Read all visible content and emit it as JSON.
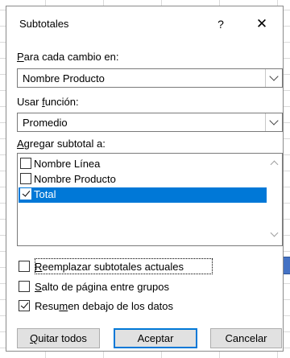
{
  "dialog": {
    "title": "Subtotales",
    "help_glyph": "?",
    "close_glyph": "✕"
  },
  "group_by": {
    "label_underlined": "P",
    "label_rest": "ara cada cambio en:",
    "value": "Nombre Producto"
  },
  "function": {
    "label_start": "Usar ",
    "label_underlined": "f",
    "label_rest": "unción:",
    "value": "Promedio"
  },
  "add_subtotal": {
    "label_underlined": "A",
    "label_rest": "gregar subtotal a:",
    "items": [
      {
        "label": "Nombre Línea",
        "checked": false,
        "selected": false
      },
      {
        "label": "Nombre Producto",
        "checked": false,
        "selected": false
      },
      {
        "label": "Total",
        "checked": true,
        "selected": true
      }
    ]
  },
  "options": {
    "replace": {
      "underlined": "R",
      "rest": "eemplazar subtotales actuales",
      "checked": false
    },
    "page_break": {
      "underlined": "S",
      "rest": "alto de página entre grupos",
      "checked": false
    },
    "summary": {
      "start": "Resu",
      "underlined": "m",
      "rest": "en debajo de los datos",
      "checked": true
    }
  },
  "buttons": {
    "remove_all": {
      "underlined": "Q",
      "rest": "uitar todos"
    },
    "ok": "Aceptar",
    "cancel": "Cancelar"
  },
  "colors": {
    "selection": "#0078d7",
    "sheet_cell": "#4472c4"
  }
}
